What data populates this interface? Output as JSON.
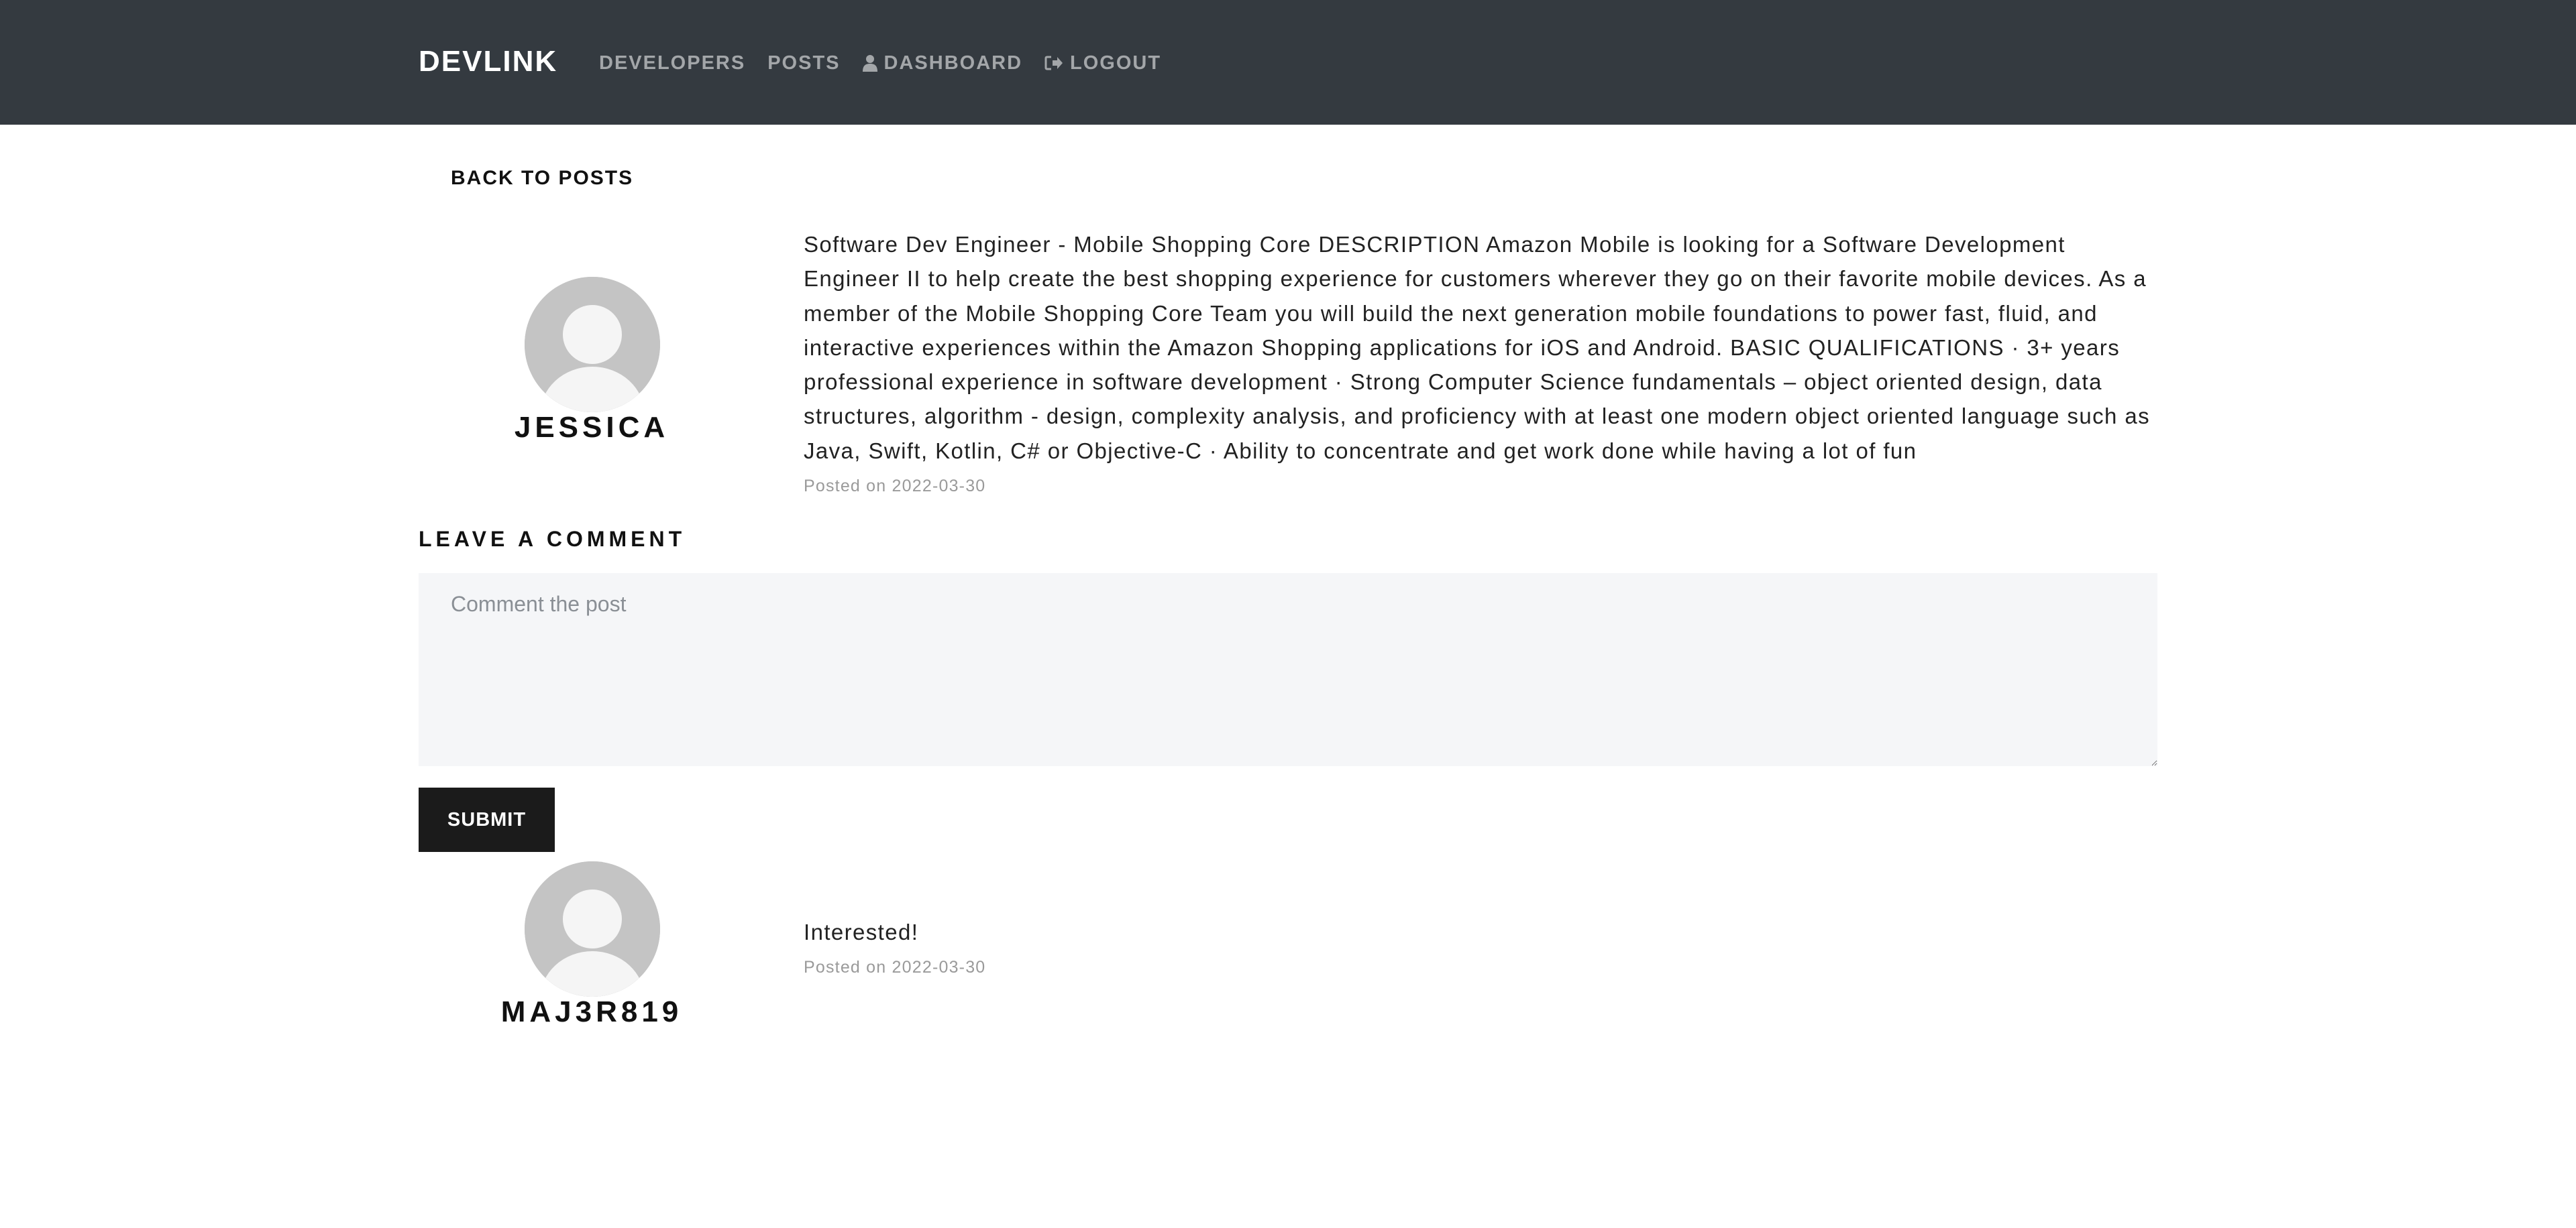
{
  "navbar": {
    "brand": "DEVLINK",
    "links": [
      {
        "label": "DEVELOPERS",
        "icon": null
      },
      {
        "label": "POSTS",
        "icon": null
      },
      {
        "label": "DASHBOARD",
        "icon": "user-icon"
      },
      {
        "label": "LOGOUT",
        "icon": "sign-out-icon"
      }
    ]
  },
  "back_link": "BACK TO POSTS",
  "post": {
    "author": "JESSICA",
    "text": "Software Dev Engineer - Mobile Shopping Core DESCRIPTION Amazon Mobile is looking for a Software Development Engineer II to help create the best shopping experience for customers wherever they go on their favorite mobile devices. As a member of the Mobile Shopping Core Team you will build the next generation mobile foundations to power fast, fluid, and interactive experiences within the Amazon Shopping applications for iOS and Android. BASIC QUALIFICATIONS · 3+ years professional experience in software development · Strong Computer Science fundamentals – object oriented design, data structures, algorithm - design, complexity analysis, and proficiency with at least one modern object oriented language such as Java, Swift, Kotlin, C# or Objective-C · Ability to concentrate and get work done while having a lot of fun",
    "date": "Posted on 2022-03-30"
  },
  "comment_form": {
    "heading": "LEAVE A COMMENT",
    "placeholder": "Comment the post",
    "value": "",
    "submit_label": "SUBMIT"
  },
  "comments": [
    {
      "author": "MAJ3R819",
      "text": "Interested!",
      "date": "Posted on 2022-03-30"
    }
  ],
  "colors": {
    "navbar_bg": "#343a40",
    "avatar_bg": "#c4c4c4",
    "submit_bg": "#1b1b1b",
    "textarea_bg": "#f5f6f8"
  }
}
